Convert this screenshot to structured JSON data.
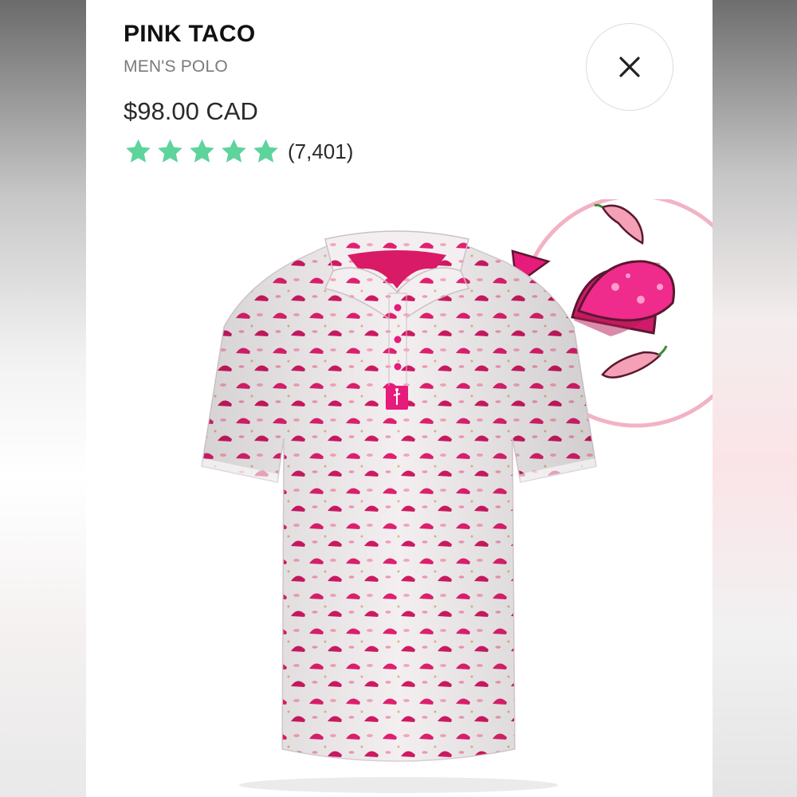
{
  "product": {
    "name": "PINK TACO",
    "category": "MEN'S POLO",
    "price": "$98.00 CAD",
    "rating": 5,
    "review_count": "(7,401)"
  },
  "colors": {
    "star": "#5fd39c",
    "pink": "#e61b7b",
    "shirt_base": "#f3eff0"
  },
  "icons": {
    "close": "close-icon",
    "star": "star-icon"
  }
}
